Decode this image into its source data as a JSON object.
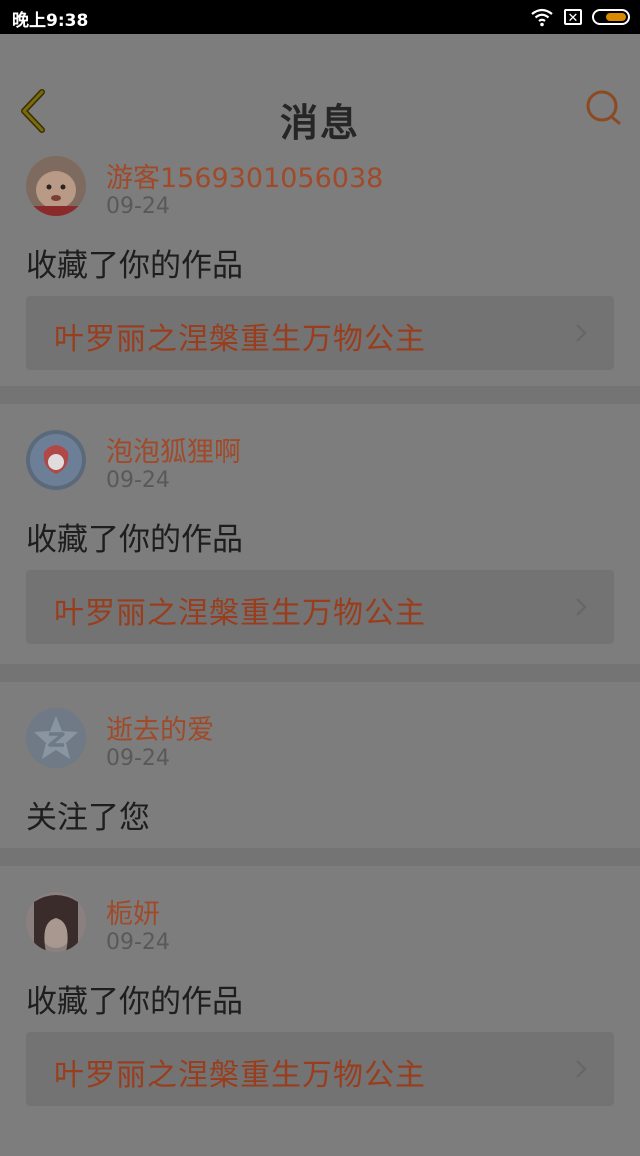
{
  "status": {
    "time": "晚上9:38",
    "close_glyph": "✕"
  },
  "header": {
    "title": "消息",
    "back_icon": "chevron-left-icon",
    "search_icon": "search-icon"
  },
  "colors": {
    "accent": "#d4682a",
    "overlay_bg": "#7d7d7d"
  },
  "messages": [
    {
      "username": "游客1569301056038",
      "date": "09-24",
      "action": "收藏了你的作品",
      "work_title": "叶罗丽之涅槃重生万物公主"
    },
    {
      "username": "泡泡狐狸啊",
      "date": "09-24",
      "action": "收藏了你的作品",
      "work_title": "叶罗丽之涅槃重生万物公主"
    },
    {
      "username": "逝去的爱",
      "date": "09-24",
      "action": "关注了您"
    },
    {
      "username": "栀妍",
      "date": "09-24",
      "action": "收藏了你的作品",
      "work_title": "叶罗丽之涅槃重生万物公主"
    }
  ]
}
